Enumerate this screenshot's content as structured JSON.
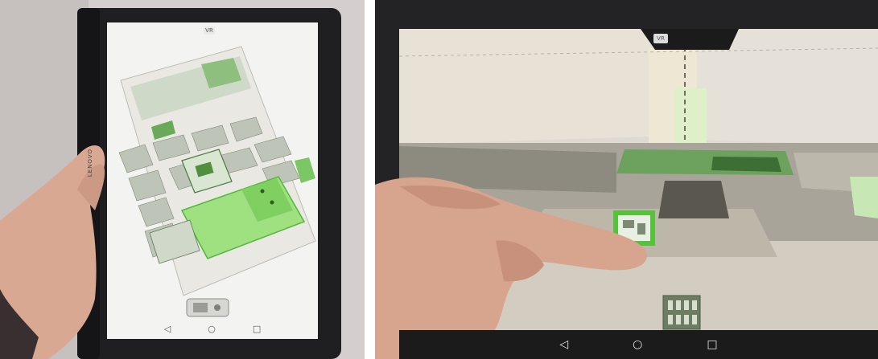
{
  "left_panel": {
    "brand_text": "LENOVO",
    "vr_badge_label": "VR",
    "nav_icons": [
      "back-triangle-icon",
      "home-circle-icon",
      "recents-square-icon"
    ],
    "nav_glyphs": {
      "back": "◁",
      "home": "○",
      "recents": "□"
    }
  },
  "right_panel": {
    "vr_badge_label": "VR",
    "nav_icons": [
      "back-triangle-icon",
      "home-circle-icon",
      "recents-square-icon"
    ],
    "nav_glyphs": {
      "back": "◁",
      "home": "○",
      "recents": "□"
    }
  },
  "colors": {
    "highlight_green": "#62c64a",
    "tablet_frame": "#1e1e20",
    "paper": "#eceae6"
  }
}
